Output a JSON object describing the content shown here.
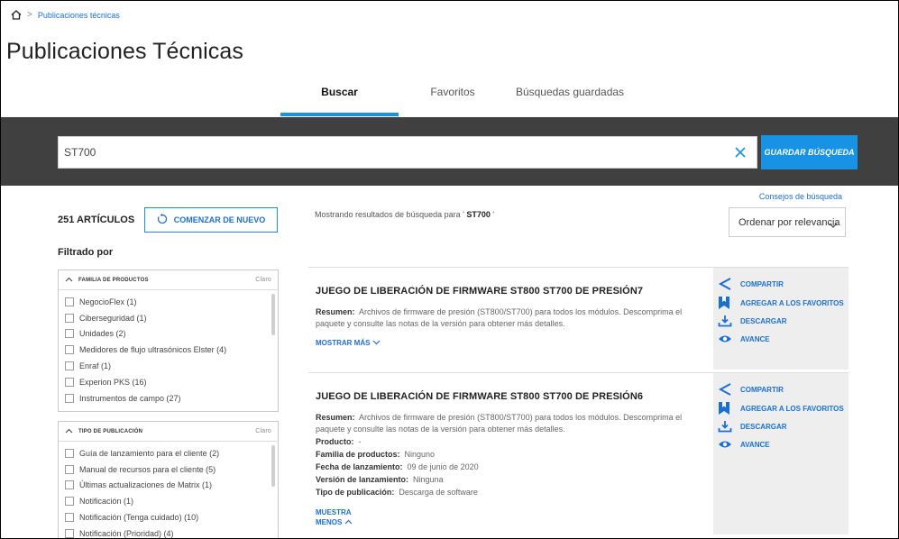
{
  "breadcrumb": {
    "current": "Publicaciones técnicas",
    "separator": ">"
  },
  "page_title": "Publicaciones Técnicas",
  "tabs": [
    {
      "label": "Buscar",
      "active": true
    },
    {
      "label": "Favoritos",
      "active": false
    },
    {
      "label": "Búsquedas guardadas",
      "active": false
    }
  ],
  "search": {
    "value": "ST700",
    "save_label": "GUARDAR BÚSQUEDA"
  },
  "tips_label": "Consejos de búsqueda",
  "results_count": "251 ARTÍCULOS",
  "restart_label": "COMENZAR DE NUEVO",
  "filtered_by": "Filtrado por",
  "facets": [
    {
      "title": "FAMILIA DE PRODUCTOS",
      "clear": "Claro",
      "options": [
        "NegocioFlex (1)",
        "Ciberseguridad (1)",
        "Unidades (2)",
        "Medidores de flujo ultrasónicos Elster (4)",
        "Enraf (1)",
        "Experion PKS (16)",
        "Instrumentos de campo (27)"
      ]
    },
    {
      "title": "TIPO DE PUBLICACIÓN",
      "clear": "Claro",
      "options": [
        "Guía de lanzamiento para el cliente (2)",
        "Manual de recursos para el cliente (5)",
        "Últimas actualizaciones de Matrix (1)",
        "Notificación (1)",
        "Notificación (Tenga cuidado) (10)",
        "Notificación (Prioridad) (4)"
      ]
    }
  ],
  "showing": {
    "prefix": "Mostrando resultados de búsqueda para ' ",
    "term": "ST700",
    "suffix": " '"
  },
  "sort_label": "Ordenar por relevancia",
  "results": [
    {
      "title": "JUEGO DE LIBERACIÓN DE FIRMWARE ST800 ST700 DE PRESIÓN7",
      "summary_label": "Resumen:",
      "summary_text": "Archivos de firmware de presión (ST800/ST700) para todos los módulos. Descomprima el paquete y consulte las notas de la versión para obtener más detalles.",
      "more_label": "MOSTRAR MÁS"
    },
    {
      "title": "JUEGO DE LIBERACIÓN DE FIRMWARE ST800 ST700 DE PRESIÓN6",
      "summary_label": "Resumen:",
      "summary_text": "Archivos de firmware de presión (ST800/ST700) para todos los módulos. Descomprima el paquete y consulte las notas de la versión para obtener más detalles.",
      "details": [
        {
          "label": "Producto:",
          "value": "-"
        },
        {
          "label": "Familia de productos:",
          "value": "Ninguno"
        },
        {
          "label": "Fecha de lanzamiento:",
          "value": "09 de junio de 2020"
        },
        {
          "label": "Versión de lanzamiento:",
          "value": "Ninguna"
        },
        {
          "label": "Tipo de publicación:",
          "value": "Descarga de software"
        }
      ],
      "show_label": "MUESTRA",
      "less_label": "MENOS"
    }
  ],
  "actions": {
    "share": "COMPARTIR",
    "favorite": "AGREGAR A LOS FAVORITOS",
    "download": "DESCARGAR",
    "preview": "AVANCE"
  },
  "colors": {
    "accent": "#1792e5",
    "link": "#1a6fd6",
    "band": "#404040",
    "side_panel": "#eeeeee"
  }
}
